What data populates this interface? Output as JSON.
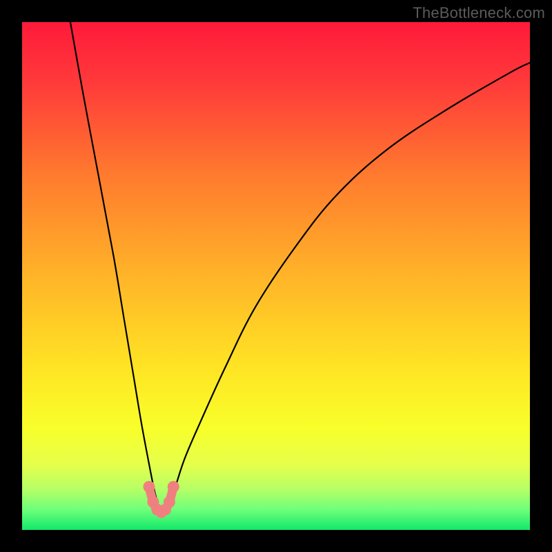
{
  "watermark": {
    "text": "TheBottleneck.com"
  },
  "colors": {
    "frame": "#000000",
    "curve": "#000000",
    "marker_fill": "#f08080",
    "marker_outline": "#e86a6a",
    "gradient_stops": [
      {
        "offset": 0.0,
        "color": "#ff1a3a"
      },
      {
        "offset": 0.12,
        "color": "#ff3a3a"
      },
      {
        "offset": 0.3,
        "color": "#ff7a2e"
      },
      {
        "offset": 0.5,
        "color": "#ffb428"
      },
      {
        "offset": 0.68,
        "color": "#ffe424"
      },
      {
        "offset": 0.8,
        "color": "#f8ff2a"
      },
      {
        "offset": 0.87,
        "color": "#e6ff4a"
      },
      {
        "offset": 0.92,
        "color": "#b6ff66"
      },
      {
        "offset": 0.96,
        "color": "#6eff7a"
      },
      {
        "offset": 1.0,
        "color": "#12e86a"
      }
    ]
  },
  "chart_data": {
    "type": "line",
    "title": "",
    "xlabel": "",
    "ylabel": "",
    "ylim": [
      0,
      100
    ],
    "xlim": [
      0,
      100
    ],
    "legend": false,
    "grid": false,
    "annotations": [],
    "notes": "V-shaped bottleneck curve on a vertical red→green gradient. x and y are relative percentages (approximate — no axis ticks shown). Minimum of curve sits near x≈27, y≈96. Markers trace the U-shaped trough segment.",
    "series": [
      {
        "name": "bottleneck-curve",
        "x": [
          9.5,
          12,
          15,
          18,
          20,
          22,
          23.5,
          25,
          26,
          26.8,
          27.5,
          28.5,
          30,
          32,
          35,
          40,
          46,
          54,
          62,
          72,
          84,
          96,
          100
        ],
        "values": [
          0,
          14,
          30,
          46,
          58,
          70,
          79,
          87,
          92,
          95,
          96.5,
          95.5,
          92,
          86,
          79,
          68,
          56,
          44,
          34,
          25,
          17,
          10,
          8
        ]
      }
    ],
    "markers": {
      "name": "trough-markers",
      "x": [
        25.0,
        25.8,
        26.6,
        27.4,
        28.2,
        29.0,
        29.8
      ],
      "values": [
        91.5,
        94.5,
        96.0,
        96.5,
        96.0,
        94.5,
        91.5
      ]
    }
  }
}
